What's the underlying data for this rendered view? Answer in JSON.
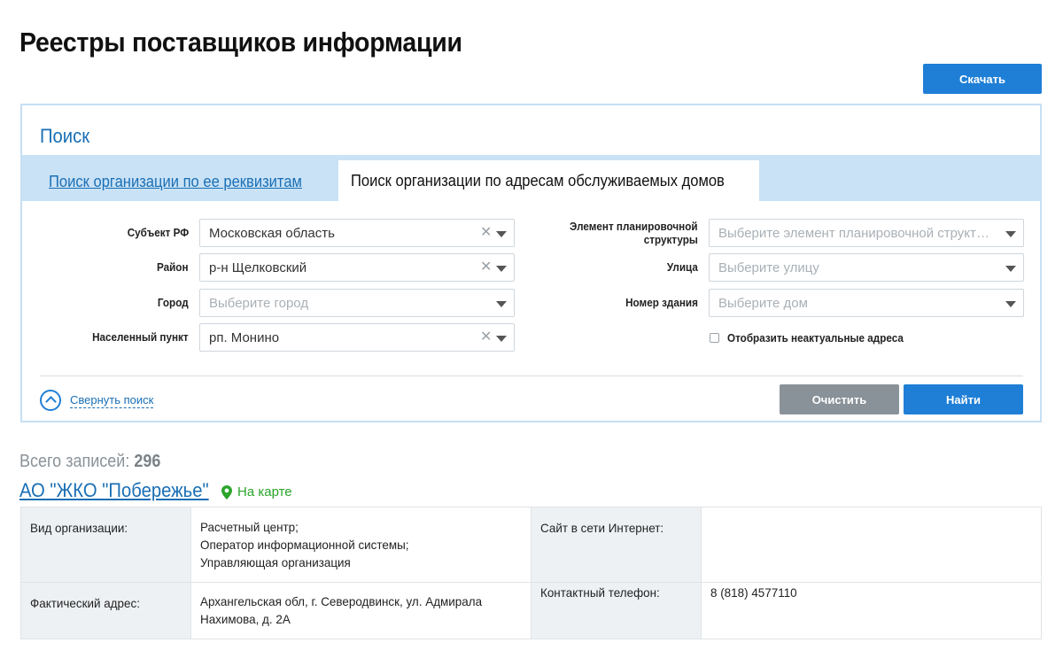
{
  "page": {
    "title": "Реестры поставщиков информации",
    "download_label": "Скачать"
  },
  "search": {
    "title": "Поиск",
    "tabs": [
      {
        "label": "Поиск организации по ее реквизитам",
        "active": false
      },
      {
        "label": "Поиск организации по адресам обслуживаемых домов",
        "active": true
      }
    ],
    "fields": {
      "subject": {
        "label": "Субъект РФ",
        "value": "Московская область"
      },
      "district": {
        "label": "Район",
        "value": "р-н Щелковский"
      },
      "city": {
        "label": "Город",
        "placeholder": "Выберите город"
      },
      "settlement": {
        "label": "Населенный пункт",
        "value": "рп. Монино"
      },
      "planning_element": {
        "label_line1": "Элемент планировочной",
        "label_line2": "структуры",
        "placeholder": "Выберите элемент планировочной структуры"
      },
      "street": {
        "label": "Улица",
        "placeholder": "Выберите улицу"
      },
      "building": {
        "label": "Номер здания",
        "placeholder": "Выберите дом"
      }
    },
    "show_inactive_label": "Отобразить неактуальные адреса",
    "show_inactive_checked": false,
    "collapse_label": "Свернуть поиск",
    "clear_label": "Очистить",
    "find_label": "Найти"
  },
  "results": {
    "total_label": "Всего записей:",
    "total_count": "296",
    "org": {
      "name": "АО \"ЖКО \"Побережье\"",
      "map_label": "На карте",
      "type_label": "Вид организации:",
      "type_lines": [
        "Расчетный центр;",
        "Оператор информационной системы;",
        "Управляющая организация"
      ],
      "site_label": "Сайт в сети Интернет:",
      "site_value": "",
      "address_label": "Фактический адрес:",
      "address_lines": [
        "Архангельская обл, г. Северодвинск, ул. Адмирала",
        "Нахимова, д. 2А"
      ],
      "phone_label": "Контактный телефон:",
      "phone_value": "8 (818) 4577110"
    }
  },
  "colors": {
    "primary": "#1f7fd6",
    "link": "#1a6fb5",
    "tab_bar": "#c9e2f6",
    "map_green": "#2aa52a",
    "gray_button": "#8a9299"
  }
}
